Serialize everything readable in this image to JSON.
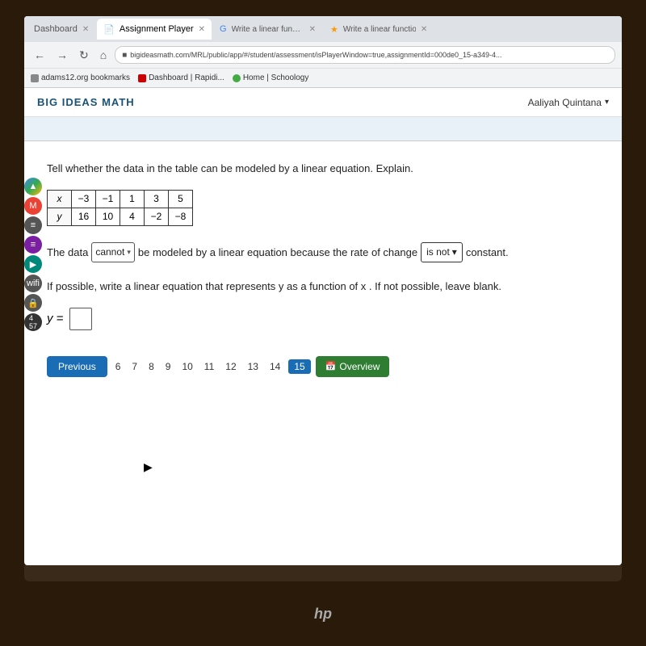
{
  "browser": {
    "tabs": [
      {
        "id": "dashboard",
        "label": "Dashboard",
        "active": false
      },
      {
        "id": "assignment-player",
        "label": "Assignment Player",
        "active": true
      },
      {
        "id": "write-linear1",
        "label": "Write a linear function $^S wit...",
        "active": false
      },
      {
        "id": "write-linear2",
        "label": "Write a linear function ^ w...",
        "active": false
      }
    ],
    "url": "bigideasmath.com/MRL/public/app/#/student/assessment/isPlayerWindow=true,assignmentId=000de0_15-a349-4...",
    "bookmarks": [
      {
        "label": "adams12.org bookmarks",
        "type": "folder"
      },
      {
        "label": "Dashboard | Rapidi...",
        "type": "red"
      },
      {
        "label": "Home | Schoology",
        "type": "green"
      }
    ]
  },
  "app": {
    "logo": "BIG IDEAS MATH",
    "user": "Aaliyah Quintana",
    "chevron": "▾"
  },
  "question": {
    "text": "Tell whether the data in the table can be modeled by a linear equation. Explain.",
    "table": {
      "headers": [
        "x",
        "-3",
        "-1",
        "1",
        "3",
        "5"
      ],
      "row": [
        "y",
        "16",
        "10",
        "4",
        "-2",
        "-8"
      ]
    },
    "sentence_parts": {
      "the_data": "The data",
      "dropdown1_value": "cannot",
      "dropdown1_arrow": "▾",
      "middle_text": "be modeled by a linear equation because the rate of change",
      "dropdown2_value": "is not",
      "dropdown2_arrow": "▾",
      "end_text": "constant."
    },
    "second_text": "If possible, write a linear equation that represents y as a function of x . If not possible, leave blank.",
    "y_equals": "y ="
  },
  "pagination": {
    "prev_label": "Previous",
    "pages": [
      "6",
      "7",
      "8",
      "9",
      "10",
      "11",
      "12",
      "13",
      "14",
      "15"
    ],
    "current": "15",
    "overview_label": "Overview"
  },
  "hp_logo": "hp"
}
